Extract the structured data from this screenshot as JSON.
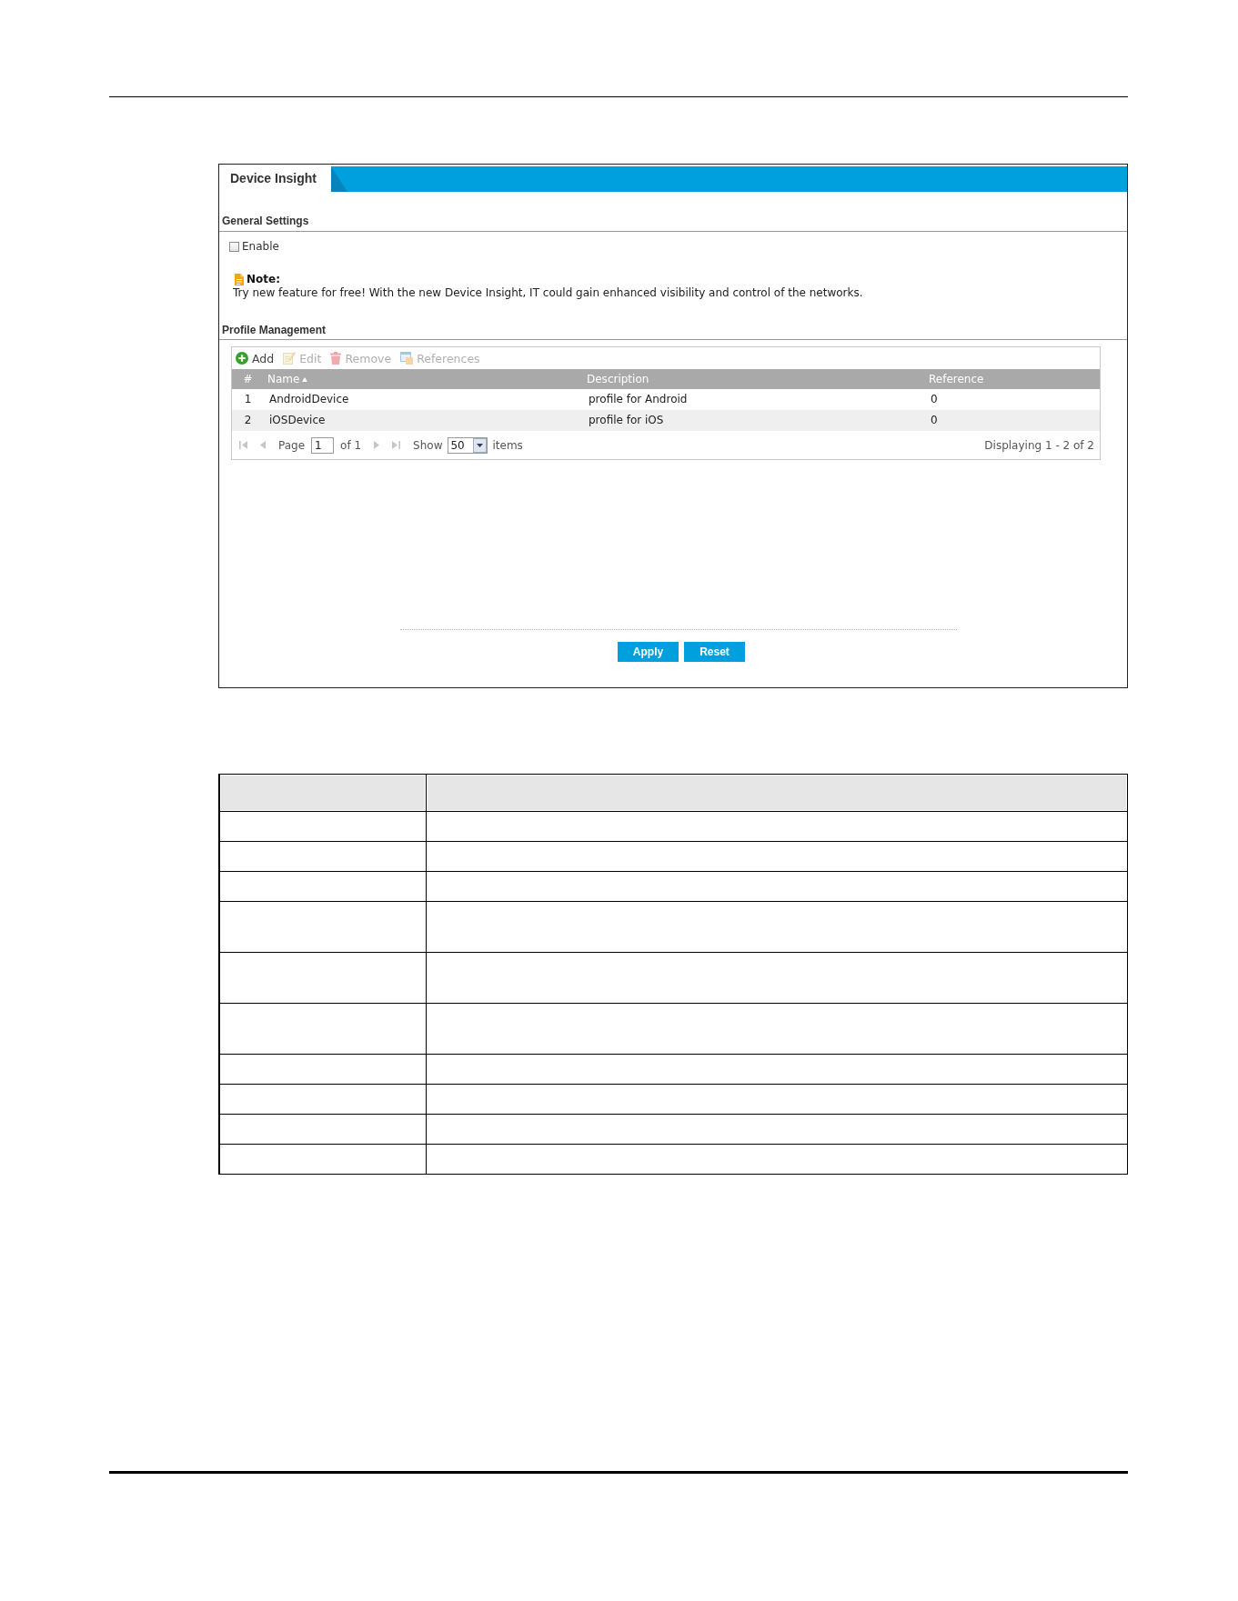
{
  "tabs": [
    {
      "label": "Device Insight",
      "selected": true
    }
  ],
  "general_settings": {
    "title": "General Settings",
    "enable": {
      "label": "Enable",
      "checked": false
    },
    "note": {
      "title": "Note:",
      "text": "Try new feature for free! With the new Device Insight, IT could gain enhanced visibility and control of the networks."
    }
  },
  "profile_management": {
    "title": "Profile Management",
    "toolbar": [
      {
        "kind": "add",
        "label": "Add",
        "disabled": false
      },
      {
        "kind": "edit",
        "label": "Edit",
        "disabled": true
      },
      {
        "kind": "remove",
        "label": "Remove",
        "disabled": true
      },
      {
        "kind": "references",
        "label": "References",
        "disabled": true
      }
    ],
    "table": {
      "columns": [
        {
          "label": "#",
          "sorted": false
        },
        {
          "label": "Name",
          "sorted": true
        },
        {
          "label": "Description",
          "sorted": false
        },
        {
          "label": "Reference",
          "sorted": false
        }
      ],
      "rows": [
        {
          "cells": [
            "1",
            "AndroidDevice",
            "profile for Android",
            "0"
          ]
        },
        {
          "cells": [
            "2",
            "iOSDevice",
            "profile for iOS",
            "0"
          ]
        }
      ]
    },
    "pager": {
      "nav_before": [
        {
          "kind": "first",
          "disabled": true
        },
        {
          "kind": "previous",
          "disabled": true
        }
      ],
      "page_label": "Page",
      "page_value": "1",
      "page_count": "of 1",
      "nav_after": [
        {
          "kind": "next",
          "disabled": true
        },
        {
          "kind": "last",
          "disabled": true
        }
      ],
      "show_label": "Show",
      "page_size": "50",
      "items_label": "items",
      "summary": "Displaying 1 - 2 of 2"
    }
  },
  "buttons": [
    {
      "label": "Apply"
    },
    {
      "label": "Reset"
    }
  ],
  "lower_table": {
    "rows": [
      {
        "kind": "header"
      },
      {
        "kind": "short"
      },
      {
        "kind": "short"
      },
      {
        "kind": "short"
      },
      {
        "kind": "tall"
      },
      {
        "kind": "tall"
      },
      {
        "kind": "tall"
      },
      {
        "kind": "short"
      },
      {
        "kind": "short"
      },
      {
        "kind": "short"
      },
      {
        "kind": "short"
      }
    ]
  }
}
